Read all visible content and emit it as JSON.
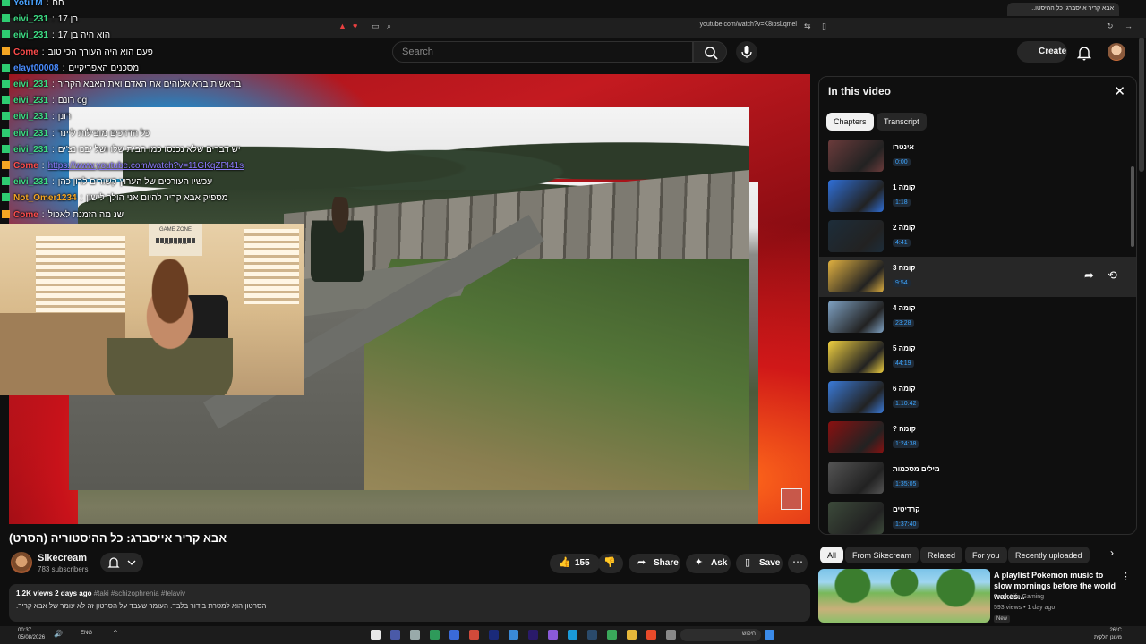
{
  "browser": {
    "tab_title": "אבא קריר אייסברג: כל ההיסטו...",
    "url": "youtube.com/watch?v=K8ipsLqmel"
  },
  "youtube": {
    "search_placeholder": "Search",
    "create_label": "Create"
  },
  "chat": [
    {
      "user": "YotiTM",
      "msg": "חח",
      "color": "#4aa3ff",
      "badge": "#2ecc71"
    },
    {
      "user": "eivi_231",
      "msg": "בן 17",
      "color": "#3ddc84",
      "badge": "#2ecc71"
    },
    {
      "user": "eivi_231",
      "msg": "הוא היה בן 17",
      "color": "#3ddc84",
      "badge": "#2ecc71"
    },
    {
      "user": "Come",
      "msg": "פעם הוא היה העורך הכי טוב",
      "color": "#ff4d4d",
      "badge": "#f5a623"
    },
    {
      "user": "elayt00008",
      "msg": "מסכנים האפריקיים",
      "color": "#4a8cff",
      "badge": "#2ecc71"
    },
    {
      "user": "eivi_231",
      "msg": "בראשית ברא אלוהים את האדם ואת האבא הקריר",
      "color": "#3ddc84",
      "badge": "#2ecc71"
    },
    {
      "user": "eivi_231",
      "msg": "רונם og",
      "color": "#3ddc84",
      "badge": "#2ecc71"
    },
    {
      "user": "eivi_231",
      "msg": "רונן",
      "color": "#3ddc84",
      "badge": "#2ecc71"
    },
    {
      "user": "eivi_231",
      "msg": "כל הדרכים מובילות ליינר",
      "color": "#3ddc84",
      "badge": "#2ecc71"
    },
    {
      "user": "eivi_231",
      "msg": "יש דברים שלא נכנסו כמו הבית שלו ושל יבנו נצ'ים",
      "color": "#3ddc84",
      "badge": "#2ecc71"
    },
    {
      "user": "Come",
      "msg": "https://www.youtube.com/watch?v=11GKqZPI41s",
      "color": "#ff4d4d",
      "badge": "#f5a623",
      "link": true
    },
    {
      "user": "eivi_231",
      "msg": "עכשיו העורכים של הערוץ קשורים לרון כהן",
      "color": "#3ddc84",
      "badge": "#2ecc71"
    },
    {
      "user": "Not_Omer1234",
      "msg": "מספיק אבא קריר להיום אני הולך לישון",
      "color": "#f5a623",
      "badge": "#2ecc71"
    },
    {
      "user": "Come",
      "msg": "שנ מה הזמנת לאכול",
      "color": "#ff4d4d",
      "badge": "#f5a623"
    }
  ],
  "webcam": {
    "sign_text": "GAME ZONE",
    "sign_sub": "LOADING"
  },
  "video": {
    "title": "אבא קריר אייסברג: כל ההיסטוריה (הסרט)",
    "channel": "Sikecream",
    "subscribers": "783 subscribers",
    "likes": "155",
    "share_label": "Share",
    "ask_label": "Ask",
    "save_label": "Save",
    "meta": "1.2K views  2 days ago",
    "tags": "#taki #schizophrenia #telaviv",
    "description": "הסרטון הוא למטרת בידור בלבד. העומר שעבד על הסרטון זה לא עומר של אבא קריר."
  },
  "panel": {
    "title": "In this video",
    "tabs": [
      "Chapters",
      "Transcript"
    ],
    "chapters": [
      {
        "title": "אינטרו",
        "time": "0:00",
        "thumb": "#6b3b3b"
      },
      {
        "title": "קומה 1",
        "time": "1:18",
        "thumb": "#2f6fd8"
      },
      {
        "title": "קומה 2",
        "time": "4:41",
        "thumb": "#1d2d3a"
      },
      {
        "title": "קומה 3",
        "time": "9:54",
        "thumb": "#e0b040",
        "active": true
      },
      {
        "title": "קומה 4",
        "time": "23:28",
        "thumb": "#7fa2c4"
      },
      {
        "title": "קומה 5",
        "time": "44:19",
        "thumb": "#f0d040"
      },
      {
        "title": "קומה 6",
        "time": "1:10:42",
        "thumb": "#3a7ad8"
      },
      {
        "title": "קומה ?",
        "time": "1:24:38",
        "thumb": "#8a1010"
      },
      {
        "title": "מילים מסכמות",
        "time": "1:35:05",
        "thumb": "#555555"
      },
      {
        "title": "קרדיטים",
        "time": "1:37:40",
        "thumb": "#3c4a3a"
      }
    ]
  },
  "chips": [
    "All",
    "From Sikecream",
    "Related",
    "For you",
    "Recently uploaded"
  ],
  "recommendation": {
    "title": "A playlist Pokemon music to slow mornings before the world wakes...",
    "channel": "Farm Life Gaming",
    "meta": "593 views • 1 day ago",
    "badge": "New"
  },
  "taskbar": {
    "time": "00:37",
    "date": "05/08/2026",
    "lang": "ENG",
    "search": "חיפוש",
    "temp": "26°C",
    "weather": "מעונן חלקית"
  }
}
